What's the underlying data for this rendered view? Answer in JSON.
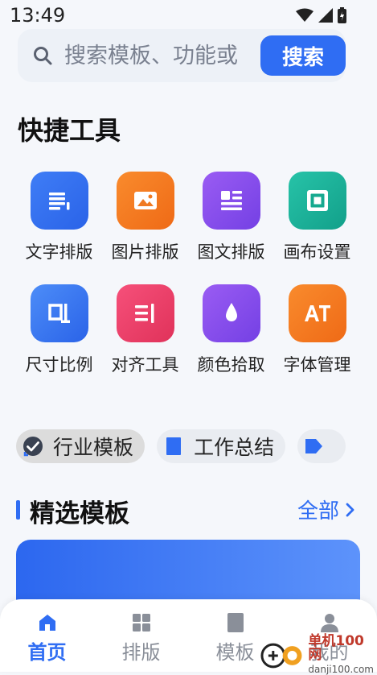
{
  "status_bar": {
    "time": "13:49"
  },
  "search": {
    "placeholder": "搜索模板、功能或",
    "button_label": "搜索"
  },
  "quick_tools": {
    "title": "快捷工具",
    "items": [
      {
        "label": "文字排版",
        "icon": "text-layout-icon",
        "color_from": "#3f7df6",
        "color_to": "#2a63e8"
      },
      {
        "label": "图片排版",
        "icon": "image-layout-icon",
        "color_from": "#f98b2d",
        "color_to": "#ef6a16"
      },
      {
        "label": "图文排版",
        "icon": "image-text-layout-icon",
        "color_from": "#9a5cf3",
        "color_to": "#7440e4"
      },
      {
        "label": "画布设置",
        "icon": "canvas-settings-icon",
        "color_from": "#27c3a8",
        "color_to": "#12a08a"
      },
      {
        "label": "尺寸比例",
        "icon": "size-ratio-icon",
        "color_from": "#4d8df8",
        "color_to": "#2a63e8"
      },
      {
        "label": "对齐工具",
        "icon": "align-tool-icon",
        "color_from": "#f6507a",
        "color_to": "#e0325a"
      },
      {
        "label": "颜色拾取",
        "icon": "color-picker-icon",
        "color_from": "#9a5cf3",
        "color_to": "#7440e4"
      },
      {
        "label": "字体管理",
        "icon": "font-manage-icon",
        "color_from": "#f98b2d",
        "color_to": "#ef6a16"
      }
    ]
  },
  "categories": [
    {
      "label": "行业模板",
      "icon": "check-badge-icon",
      "active": true
    },
    {
      "label": "工作总结",
      "icon": "document-icon",
      "active": false
    },
    {
      "label": "",
      "icon": "tag-icon",
      "active": false
    }
  ],
  "featured": {
    "title": "精选模板",
    "view_all": "全部"
  },
  "bottom_nav": [
    {
      "label": "首页",
      "icon": "home-icon",
      "active": true
    },
    {
      "label": "排版",
      "icon": "grid-icon",
      "active": false
    },
    {
      "label": "模板",
      "icon": "bookmark-icon",
      "active": false
    },
    {
      "label": "我的",
      "icon": "profile-icon",
      "active": false
    }
  ],
  "watermark": {
    "main": "单机100网",
    "sub": "danji100.com"
  },
  "colors": {
    "accent": "#2f6df3",
    "background": "#f5f7fb"
  }
}
